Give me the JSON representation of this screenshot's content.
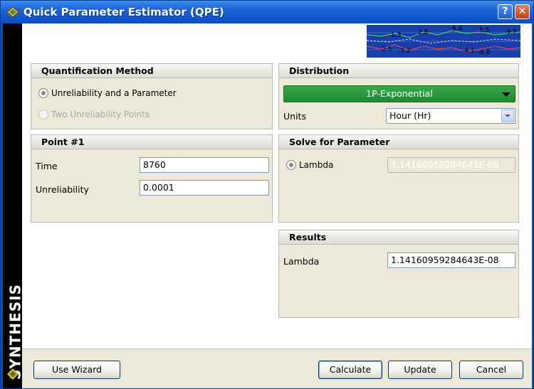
{
  "window": {
    "title": "Quick Parameter Estimator (QPE)",
    "help": "?",
    "close": "✕"
  },
  "sidebar": {
    "brand": "SYNTHESIS"
  },
  "thumbnail": {
    "labels": [
      "1.3",
      "2.8",
      "6.4",
      "5.5",
      "3.7",
      "-2.5",
      "-3.2",
      "-4.1",
      "-6.8"
    ]
  },
  "quant": {
    "header": "Quantification Method",
    "option1": "Unreliability and a Parameter",
    "option2": "Two Unreliability Points",
    "selected": "Unreliability and a Parameter"
  },
  "distribution": {
    "header": "Distribution",
    "selected": "1P-Exponential",
    "units_label": "Units",
    "units_value": "Hour (Hr)",
    "accent": "#1f8a34"
  },
  "point1": {
    "header": "Point #1",
    "time_label": "Time",
    "time_value": "8760",
    "unrel_label": "Unreliability",
    "unrel_value": "0.0001"
  },
  "solve": {
    "header": "Solve for Parameter",
    "option": "Lambda",
    "value": "1.14160959284643E-08"
  },
  "results": {
    "header": "Results",
    "lambda_label": "Lambda",
    "lambda_value": "1.14160959284643E-08"
  },
  "buttons": {
    "wizard": "Use Wizard",
    "calculate": "Calculate",
    "update": "Update",
    "cancel": "Cancel"
  }
}
